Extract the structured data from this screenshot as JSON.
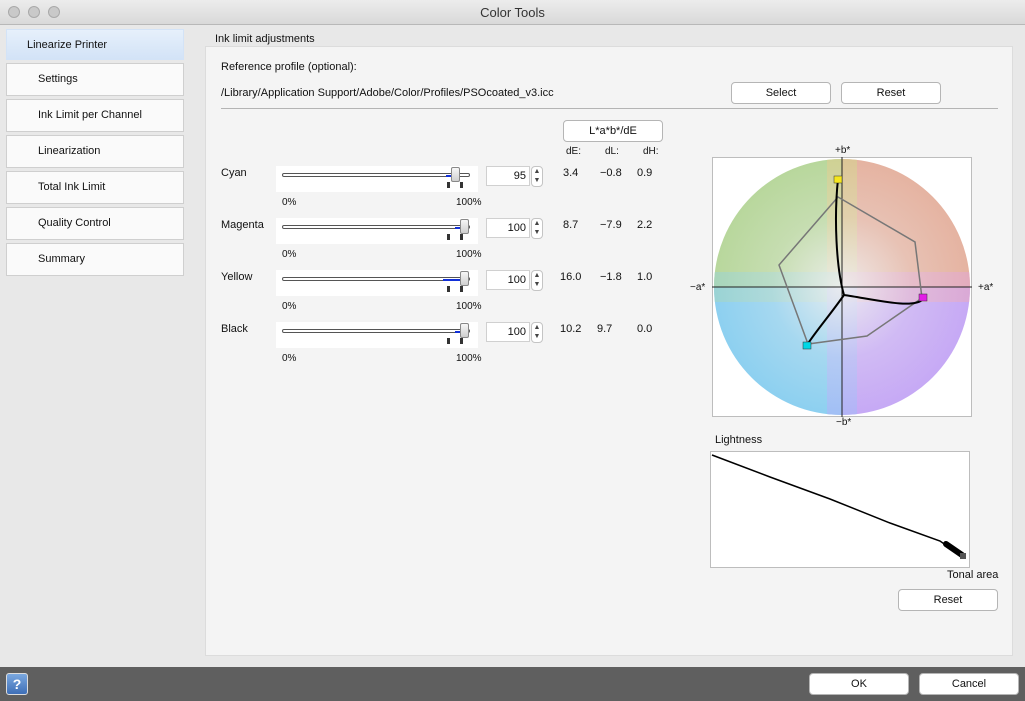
{
  "window": {
    "title": "Color Tools"
  },
  "sidebar": {
    "items": [
      {
        "label": "Linearize Printer",
        "active": true
      },
      {
        "label": "Settings"
      },
      {
        "label": "Ink Limit per Channel"
      },
      {
        "label": "Linearization"
      },
      {
        "label": "Total Ink Limit"
      },
      {
        "label": "Quality Control"
      },
      {
        "label": "Summary"
      }
    ]
  },
  "main": {
    "group_label": "Ink limit adjustments",
    "reference": {
      "label": "Reference profile (optional):",
      "path": "/Library/Application Support/Adobe/Color/Profiles/PSOcoated_v3.icc",
      "select_label": "Select",
      "reset_label": "Reset"
    },
    "mode_button": "L*a*b*/dE",
    "columns": {
      "de": "dE:",
      "dl": "dL:",
      "dh": "dH:"
    },
    "min_label": "0%",
    "max_label": "100%",
    "channels": [
      {
        "name": "Cyan",
        "value": "95",
        "level": 0.95,
        "dE": "3.4",
        "dL": "−0.8",
        "dH": "0.9"
      },
      {
        "name": "Magenta",
        "value": "100",
        "level": 1.0,
        "dE": "8.7",
        "dL": "−7.9",
        "dH": "2.2"
      },
      {
        "name": "Yellow",
        "value": "100",
        "level": 1.0,
        "dE": "16.0",
        "dL": "−1.8",
        "dH": "1.0"
      },
      {
        "name": "Black",
        "value": "100",
        "level": 1.0,
        "dE": "10.2",
        "dL": "9.7",
        "dH": "0.0"
      }
    ],
    "gamut": {
      "plus_b": "+b*",
      "minus_b": "−b*",
      "minus_a": "−a*",
      "plus_a": "+a*"
    },
    "lightness": {
      "title": "Lightness",
      "xlabel": "Tonal area"
    },
    "chart_reset_label": "Reset"
  },
  "footer": {
    "help_label": "?",
    "ok_label": "OK",
    "cancel_label": "Cancel"
  },
  "colors": {
    "cyan_marker": "#00d7e6",
    "magenta_marker": "#e21ee6",
    "yellow_marker": "#f5e61e",
    "slider_fill": "#1230d8"
  }
}
